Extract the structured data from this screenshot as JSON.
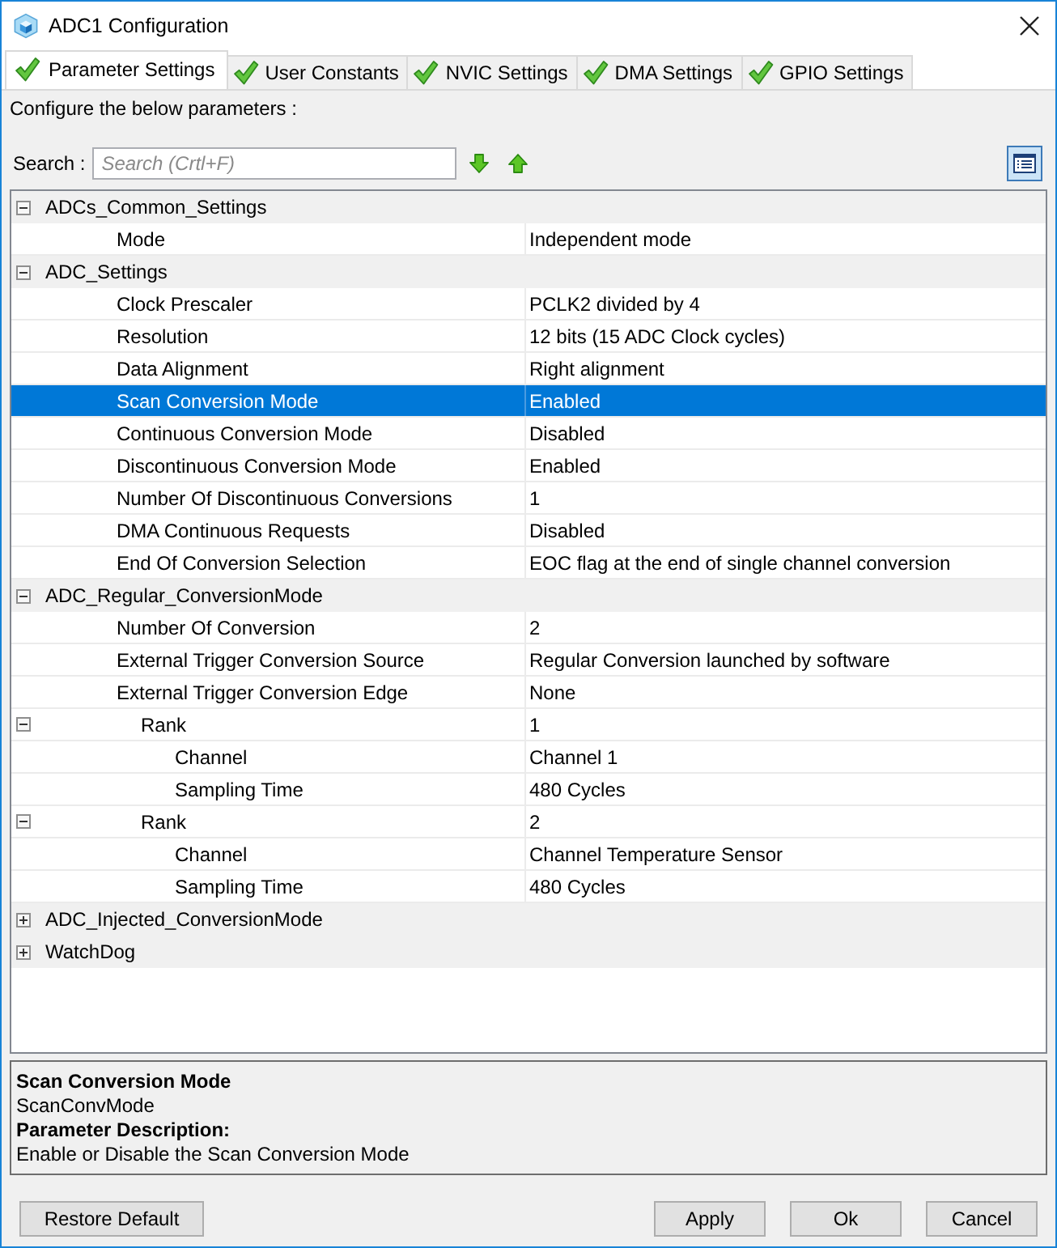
{
  "window": {
    "title": "ADC1 Configuration"
  },
  "tabs": [
    {
      "label": "Parameter Settings",
      "selected": true
    },
    {
      "label": "User Constants",
      "selected": false
    },
    {
      "label": "NVIC Settings",
      "selected": false
    },
    {
      "label": "DMA Settings",
      "selected": false
    },
    {
      "label": "GPIO Settings",
      "selected": false
    }
  ],
  "instruction": "Configure the below parameters :",
  "search": {
    "label": "Search :",
    "placeholder": "Search (Crtl+F)"
  },
  "tree": [
    {
      "name": "ADCs_Common_Settings",
      "expanded": true,
      "selected": false,
      "children": [
        {
          "name": "Mode",
          "value": "Independent mode",
          "selected": false
        }
      ]
    },
    {
      "name": "ADC_Settings",
      "expanded": true,
      "selected": false,
      "children": [
        {
          "name": "Clock Prescaler",
          "value": "PCLK2 divided by 4",
          "selected": false
        },
        {
          "name": "Resolution",
          "value": "12 bits (15 ADC Clock cycles)",
          "selected": false
        },
        {
          "name": "Data Alignment",
          "value": "Right alignment",
          "selected": false
        },
        {
          "name": "Scan Conversion Mode",
          "value": "Enabled",
          "selected": true
        },
        {
          "name": "Continuous Conversion Mode",
          "value": "Disabled",
          "selected": false
        },
        {
          "name": "Discontinuous Conversion Mode",
          "value": "Enabled",
          "selected": false
        },
        {
          "name": "Number Of Discontinuous Conversions",
          "value": "1",
          "selected": false
        },
        {
          "name": "DMA Continuous Requests",
          "value": "Disabled",
          "selected": false
        },
        {
          "name": "End Of Conversion Selection",
          "value": "EOC flag at the end of single channel conversion",
          "selected": false
        }
      ]
    },
    {
      "name": "ADC_Regular_ConversionMode",
      "expanded": true,
      "selected": false,
      "children": [
        {
          "name": "Number Of Conversion",
          "value": "2",
          "selected": false
        },
        {
          "name": "External Trigger Conversion Source",
          "value": "Regular Conversion launched by software",
          "selected": false
        },
        {
          "name": "External Trigger Conversion Edge",
          "value": "None",
          "selected": false
        },
        {
          "name": "Rank",
          "value": "1",
          "expanded": true,
          "selected": false,
          "children": [
            {
              "name": "Channel",
              "value": "Channel 1",
              "selected": false
            },
            {
              "name": "Sampling Time",
              "value": "480 Cycles",
              "selected": false
            }
          ]
        },
        {
          "name": "Rank",
          "value": "2",
          "expanded": true,
          "selected": false,
          "children": [
            {
              "name": "Channel",
              "value": "Channel Temperature Sensor",
              "selected": false
            },
            {
              "name": "Sampling Time",
              "value": "480 Cycles",
              "selected": false
            }
          ]
        }
      ]
    },
    {
      "name": "ADC_Injected_ConversionMode",
      "expanded": false,
      "selected": false
    },
    {
      "name": "WatchDog",
      "expanded": false,
      "selected": false
    }
  ],
  "description": {
    "title": "Scan Conversion Mode",
    "identifier": "ScanConvMode",
    "heading": "Parameter Description:",
    "text": "Enable or Disable the Scan Conversion Mode"
  },
  "footer": {
    "left": [
      "Restore Default"
    ],
    "right": [
      "Apply",
      "Ok",
      "Cancel"
    ]
  }
}
